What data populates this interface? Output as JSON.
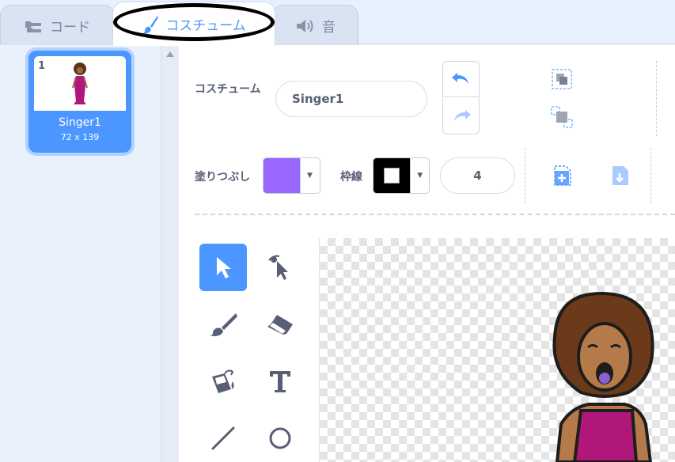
{
  "tabs": {
    "code": "コード",
    "costumes": "コスチューム",
    "sounds": "音"
  },
  "costume_list": [
    {
      "number": "1",
      "name": "Singer1",
      "size": "72 x 139"
    }
  ],
  "editor": {
    "costume_label": "コスチューム",
    "costume_name": "Singer1",
    "fill_label": "塗りつぶし",
    "fill_color": "#9966ff",
    "outline_label": "枠線",
    "outline_color": "#000000",
    "outline_width": "4"
  },
  "colors": {
    "accent": "#4c97ff",
    "text": "#575e75"
  },
  "tools": [
    "select-tool",
    "reshape-tool",
    "brush-tool",
    "eraser-tool",
    "fill-tool",
    "text-tool",
    "line-tool",
    "circle-tool"
  ]
}
